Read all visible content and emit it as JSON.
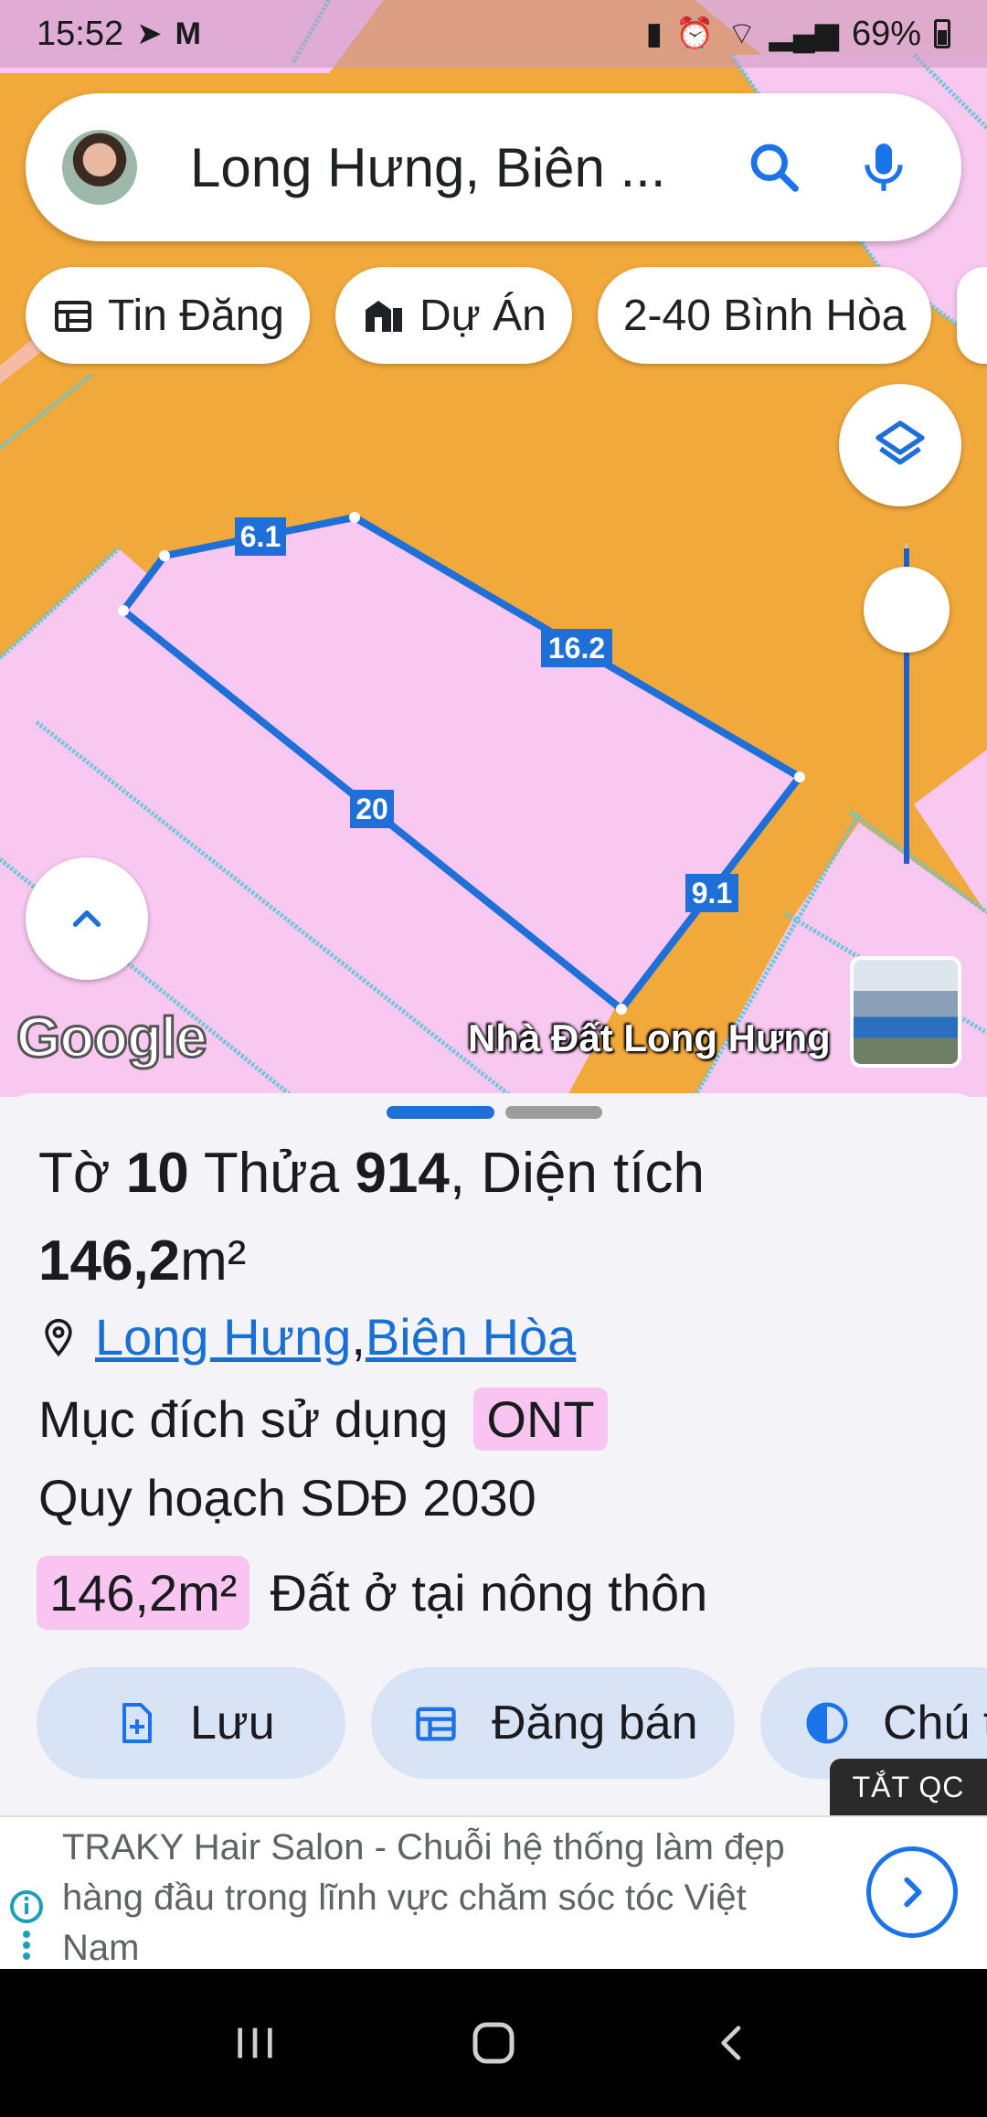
{
  "status_bar": {
    "time": "15:52",
    "battery": "69%"
  },
  "search": {
    "query": "Long Hưng, Biên ..."
  },
  "chips": [
    {
      "icon": "calendar-icon",
      "label": "Tin Đăng"
    },
    {
      "icon": "building-icon",
      "label": "Dự Án"
    },
    {
      "icon": "",
      "label": "2-40 Bình Hòa"
    }
  ],
  "parcel": {
    "edges": [
      "6.1",
      "16.2",
      "20",
      "9.1"
    ]
  },
  "map": {
    "attribution": "Google",
    "place_label": "Nhà Đất Long Hưng"
  },
  "sheet": {
    "title": {
      "prefix": "Tờ ",
      "sheet_no": "10",
      "mid": " Thửa ",
      "parcel_no": "914",
      "suffix": ", Diện tích ",
      "area": "146,2",
      "unit": "m²"
    },
    "location": {
      "ward": "Long Hưng",
      "separator": ", ",
      "city": "Biên Hòa"
    },
    "purpose": {
      "label": "Mục đích sử dụng",
      "code": "ONT"
    },
    "plan_label": "Quy hoạch SDĐ 2030",
    "land_use": {
      "area": "146,2m²",
      "description": "Đất ở tại nông thôn"
    },
    "actions": [
      {
        "icon": "add-file-icon",
        "label": "Lưu"
      },
      {
        "icon": "calendar-icon",
        "label": "Đăng bán"
      },
      {
        "icon": "contrast-icon",
        "label": "Chú t"
      }
    ]
  },
  "ad": {
    "close_label": "TẮT QC",
    "text": "TRAKY Hair Salon - Chuỗi hệ thống làm đẹp hàng đầu trong lĩnh vực chăm sóc tóc Việt Nam"
  },
  "colors": {
    "accent": "#1a73e8",
    "map_orange": "#f2a93b",
    "parcel_pink": "#f8c8f0",
    "boundary": "#1f6fd8"
  }
}
